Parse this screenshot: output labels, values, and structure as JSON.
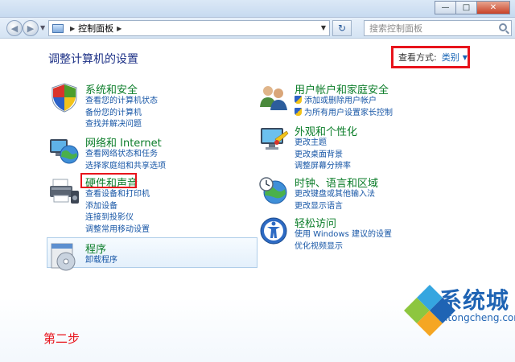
{
  "address_bar": {
    "root": "控制面板"
  },
  "search": {
    "placeholder": "搜索控制面板"
  },
  "page_title": "调整计算机的设置",
  "view_by": {
    "label": "查看方式:",
    "value": "类别"
  },
  "categories": {
    "system_security": {
      "title": "系统和安全",
      "links": [
        "查看您的计算机状态",
        "备份您的计算机",
        "查找并解决问题"
      ]
    },
    "network": {
      "title": "网络和 Internet",
      "links": [
        "查看网络状态和任务",
        "选择家庭组和共享选项"
      ]
    },
    "hardware_sound": {
      "title": "硬件和声音",
      "links": [
        "查看设备和打印机",
        "添加设备",
        "连接到投影仪",
        "调整常用移动设置"
      ]
    },
    "programs": {
      "title": "程序",
      "links": [
        "卸载程序"
      ]
    },
    "user_accounts": {
      "title": "用户帐户和家庭安全",
      "links": [
        "添加或删除用户帐户",
        "为所有用户设置家长控制"
      ]
    },
    "appearance": {
      "title": "外观和个性化",
      "links": [
        "更改主题",
        "更改桌面背景",
        "调整屏幕分辨率"
      ]
    },
    "clock_region": {
      "title": "时钟、语言和区域",
      "links": [
        "更改键盘或其他输入法",
        "更改显示语言"
      ]
    },
    "ease_access": {
      "title": "轻松访问",
      "links": [
        "使用 Windows 建议的设置",
        "优化视频显示"
      ]
    }
  },
  "annotation": {
    "step": "第二步"
  },
  "watermark": {
    "brand": "系统城",
    "url": "xitongcheng.com"
  }
}
